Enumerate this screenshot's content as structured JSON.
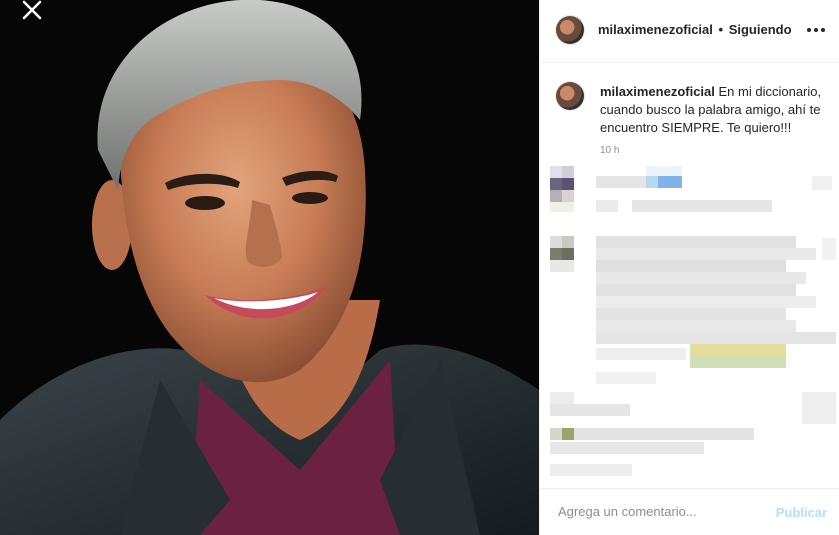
{
  "post": {
    "username": "milaximenezoficial",
    "separator": "•",
    "follow_status": "Siguiendo",
    "caption": "En mi diccionario, cuando busco la palabra amigo, ahí te encuentro SIEMPRE. Te quiero!!!",
    "time": "10 h"
  },
  "icons": {
    "close": "close-icon",
    "more": "more-options-icon"
  },
  "comment_box": {
    "placeholder": "Agrega un comentario...",
    "publish_label": "Publicar"
  },
  "colors": {
    "publish_disabled": "#b2dffc",
    "text": "#262626",
    "muted": "#8e8e8e",
    "divider": "#efefef"
  }
}
